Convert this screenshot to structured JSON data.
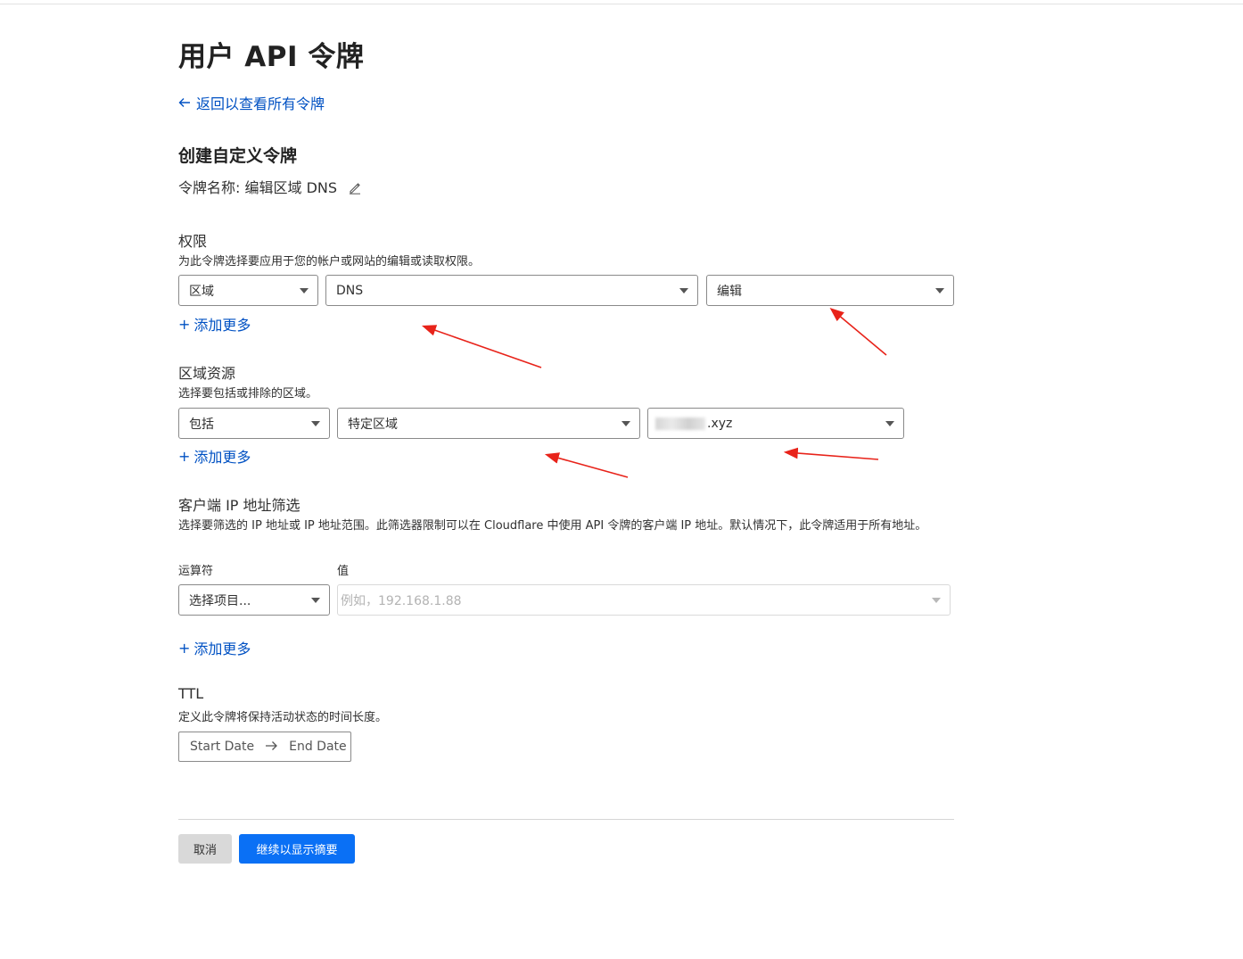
{
  "page": {
    "title": "用户 API 令牌",
    "back_link": "返回以查看所有令牌",
    "section_title": "创建自定义令牌",
    "token_name_label": "令牌名称:",
    "token_name_value": "编辑区域 DNS"
  },
  "permissions": {
    "title": "权限",
    "desc": "为此令牌选择要应用于您的帐户或网站的编辑或读取权限。",
    "select1": "区域",
    "select2": "DNS",
    "select3": "编辑",
    "add_more": "添加更多"
  },
  "zone_resources": {
    "title": "区域资源",
    "desc": "选择要包括或排除的区域。",
    "select1": "包括",
    "select2": "特定区域",
    "select3_suffix": ".xyz",
    "add_more": "添加更多"
  },
  "client_ip": {
    "title": "客户端 IP 地址筛选",
    "desc": "选择要筛选的 IP 地址或 IP 地址范围。此筛选器限制可以在 Cloudflare 中使用 API 令牌的客户端 IP 地址。默认情况下，此令牌适用于所有地址。",
    "operator_label": "运算符",
    "value_label": "值",
    "operator_placeholder": "选择项目...",
    "value_placeholder": "例如，192.168.1.88",
    "add_more": "添加更多"
  },
  "ttl": {
    "title": "TTL",
    "desc": "定义此令牌将保持活动状态的时间长度。",
    "start_date": "Start Date",
    "end_date": "End Date"
  },
  "footer": {
    "cancel": "取消",
    "continue": "继续以显示摘要"
  },
  "colors": {
    "link": "#0051c3",
    "primary_button": "#0a70f5",
    "annotation_arrow": "#e8231a"
  },
  "icons": [
    "arrow-left-icon",
    "pencil-icon",
    "plus-icon",
    "caret-down-icon",
    "arrow-right-icon"
  ]
}
